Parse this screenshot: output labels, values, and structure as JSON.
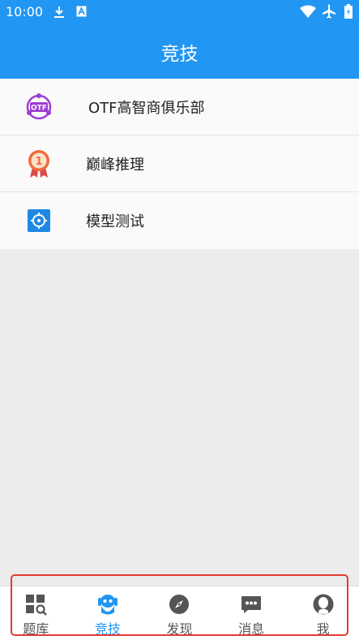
{
  "status_bar": {
    "time": "10:00",
    "icons": [
      "download-icon",
      "a-icon",
      "wifi-icon",
      "airplane-icon",
      "battery-icon"
    ]
  },
  "app_bar": {
    "title": "竞技"
  },
  "list": {
    "items": [
      {
        "label": "OTF高智商俱乐部",
        "icon": "otf-logo-icon"
      },
      {
        "label": "巅峰推理",
        "icon": "medal-icon"
      },
      {
        "label": "模型测试",
        "icon": "target-icon"
      }
    ]
  },
  "bottom_nav": {
    "items": [
      {
        "label": "题库",
        "icon": "grid-search-icon"
      },
      {
        "label": "竞技",
        "icon": "mascot-icon",
        "active": true
      },
      {
        "label": "发现",
        "icon": "compass-icon"
      },
      {
        "label": "消息",
        "icon": "message-icon"
      },
      {
        "label": "我",
        "icon": "profile-icon"
      }
    ]
  },
  "colors": {
    "primary": "#2196f3",
    "highlight": "#e53935",
    "otf_purple": "#9c3cd6",
    "medal_orange": "#f26a3d"
  }
}
